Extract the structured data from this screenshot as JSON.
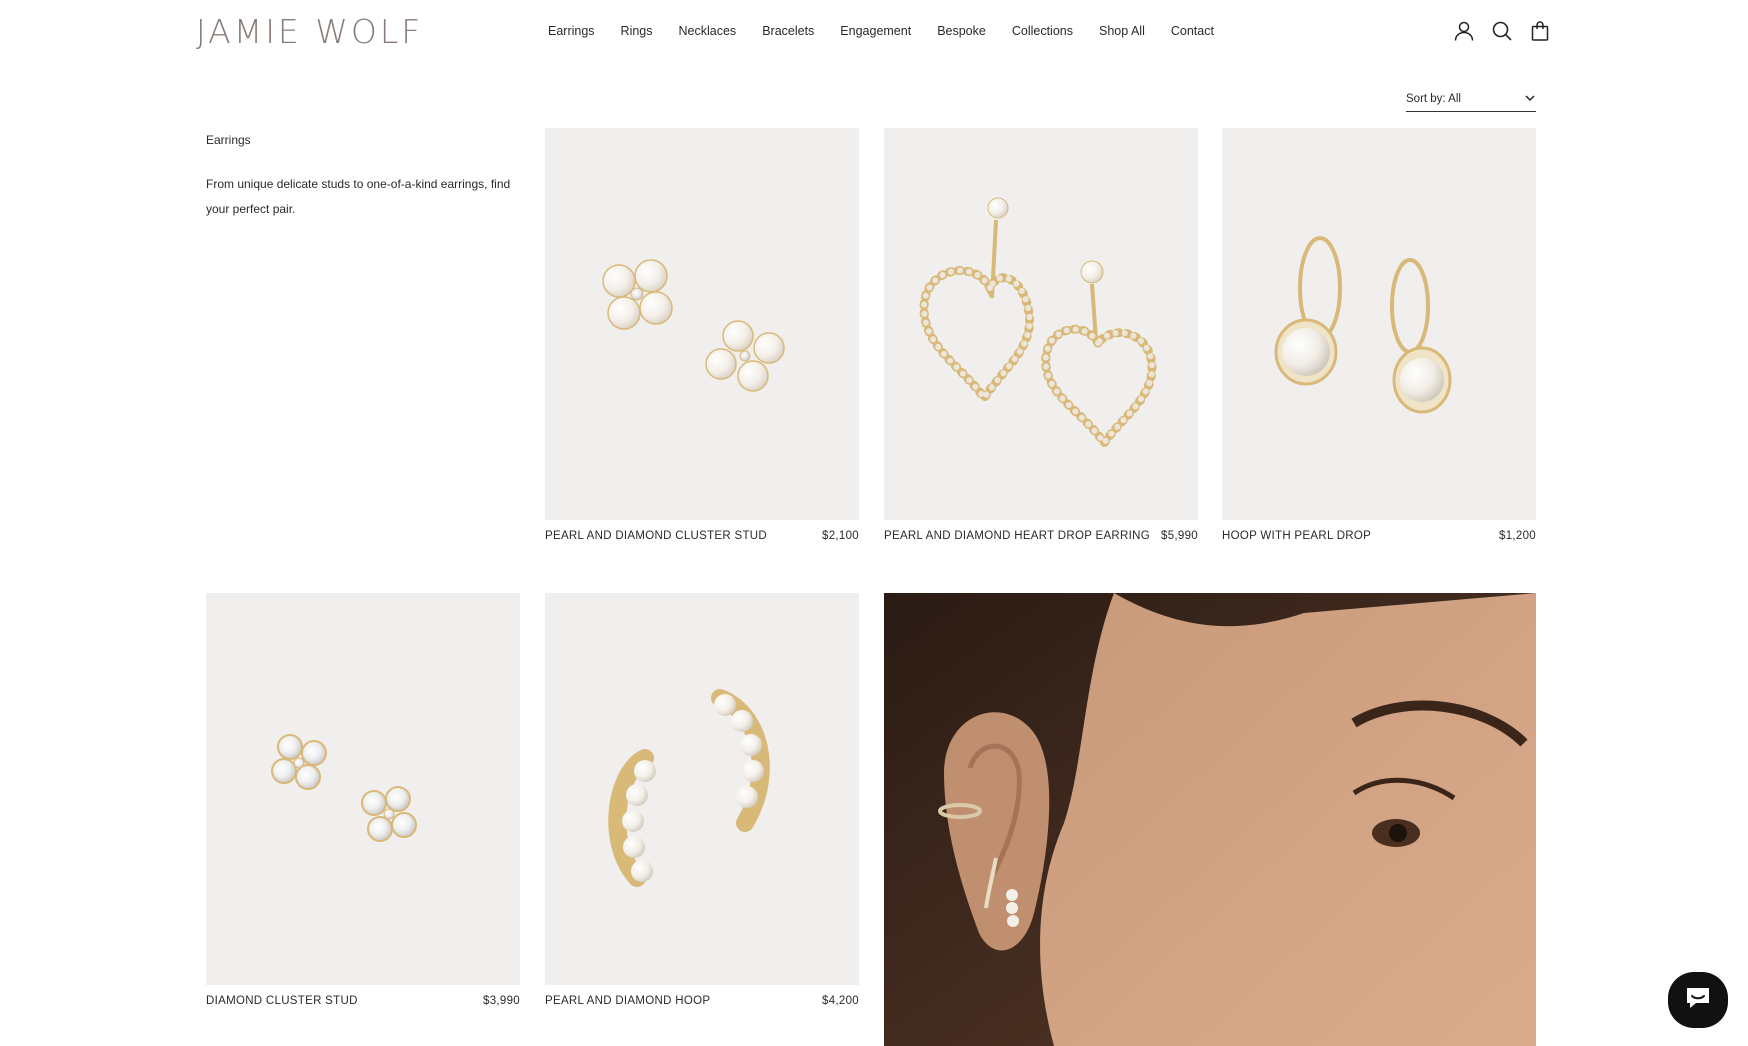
{
  "brand": {
    "logo": "JAMIE WOLF"
  },
  "nav": {
    "items": [
      "Earrings",
      "Rings",
      "Necklaces",
      "Bracelets",
      "Engagement",
      "Bespoke",
      "Collections",
      "Shop All",
      "Contact"
    ]
  },
  "header_icons": [
    "account-icon",
    "search-icon",
    "bag-icon"
  ],
  "sort": {
    "label": "Sort by: All"
  },
  "category": {
    "title": "Earrings",
    "description": "From unique delicate studs to one-of-a-kind earrings, find your perfect pair."
  },
  "products": [
    {
      "name": "PEARL AND DIAMOND CLUSTER STUD",
      "price": "$2,100"
    },
    {
      "name": "PEARL AND DIAMOND HEART DROP EARRING",
      "price": "$5,990"
    },
    {
      "name": "HOOP WITH PEARL DROP",
      "price": "$1,200"
    },
    {
      "name": "DIAMOND CLUSTER STUD",
      "price": "$3,990"
    },
    {
      "name": "PEARL AND DIAMOND HOOP",
      "price": "$4,200"
    }
  ],
  "colors": {
    "logo": "#8a7d78",
    "product_bg": "#f0efee",
    "text": "#2a2a2a",
    "gold": "#d9b978",
    "chat_bg": "#111111"
  }
}
